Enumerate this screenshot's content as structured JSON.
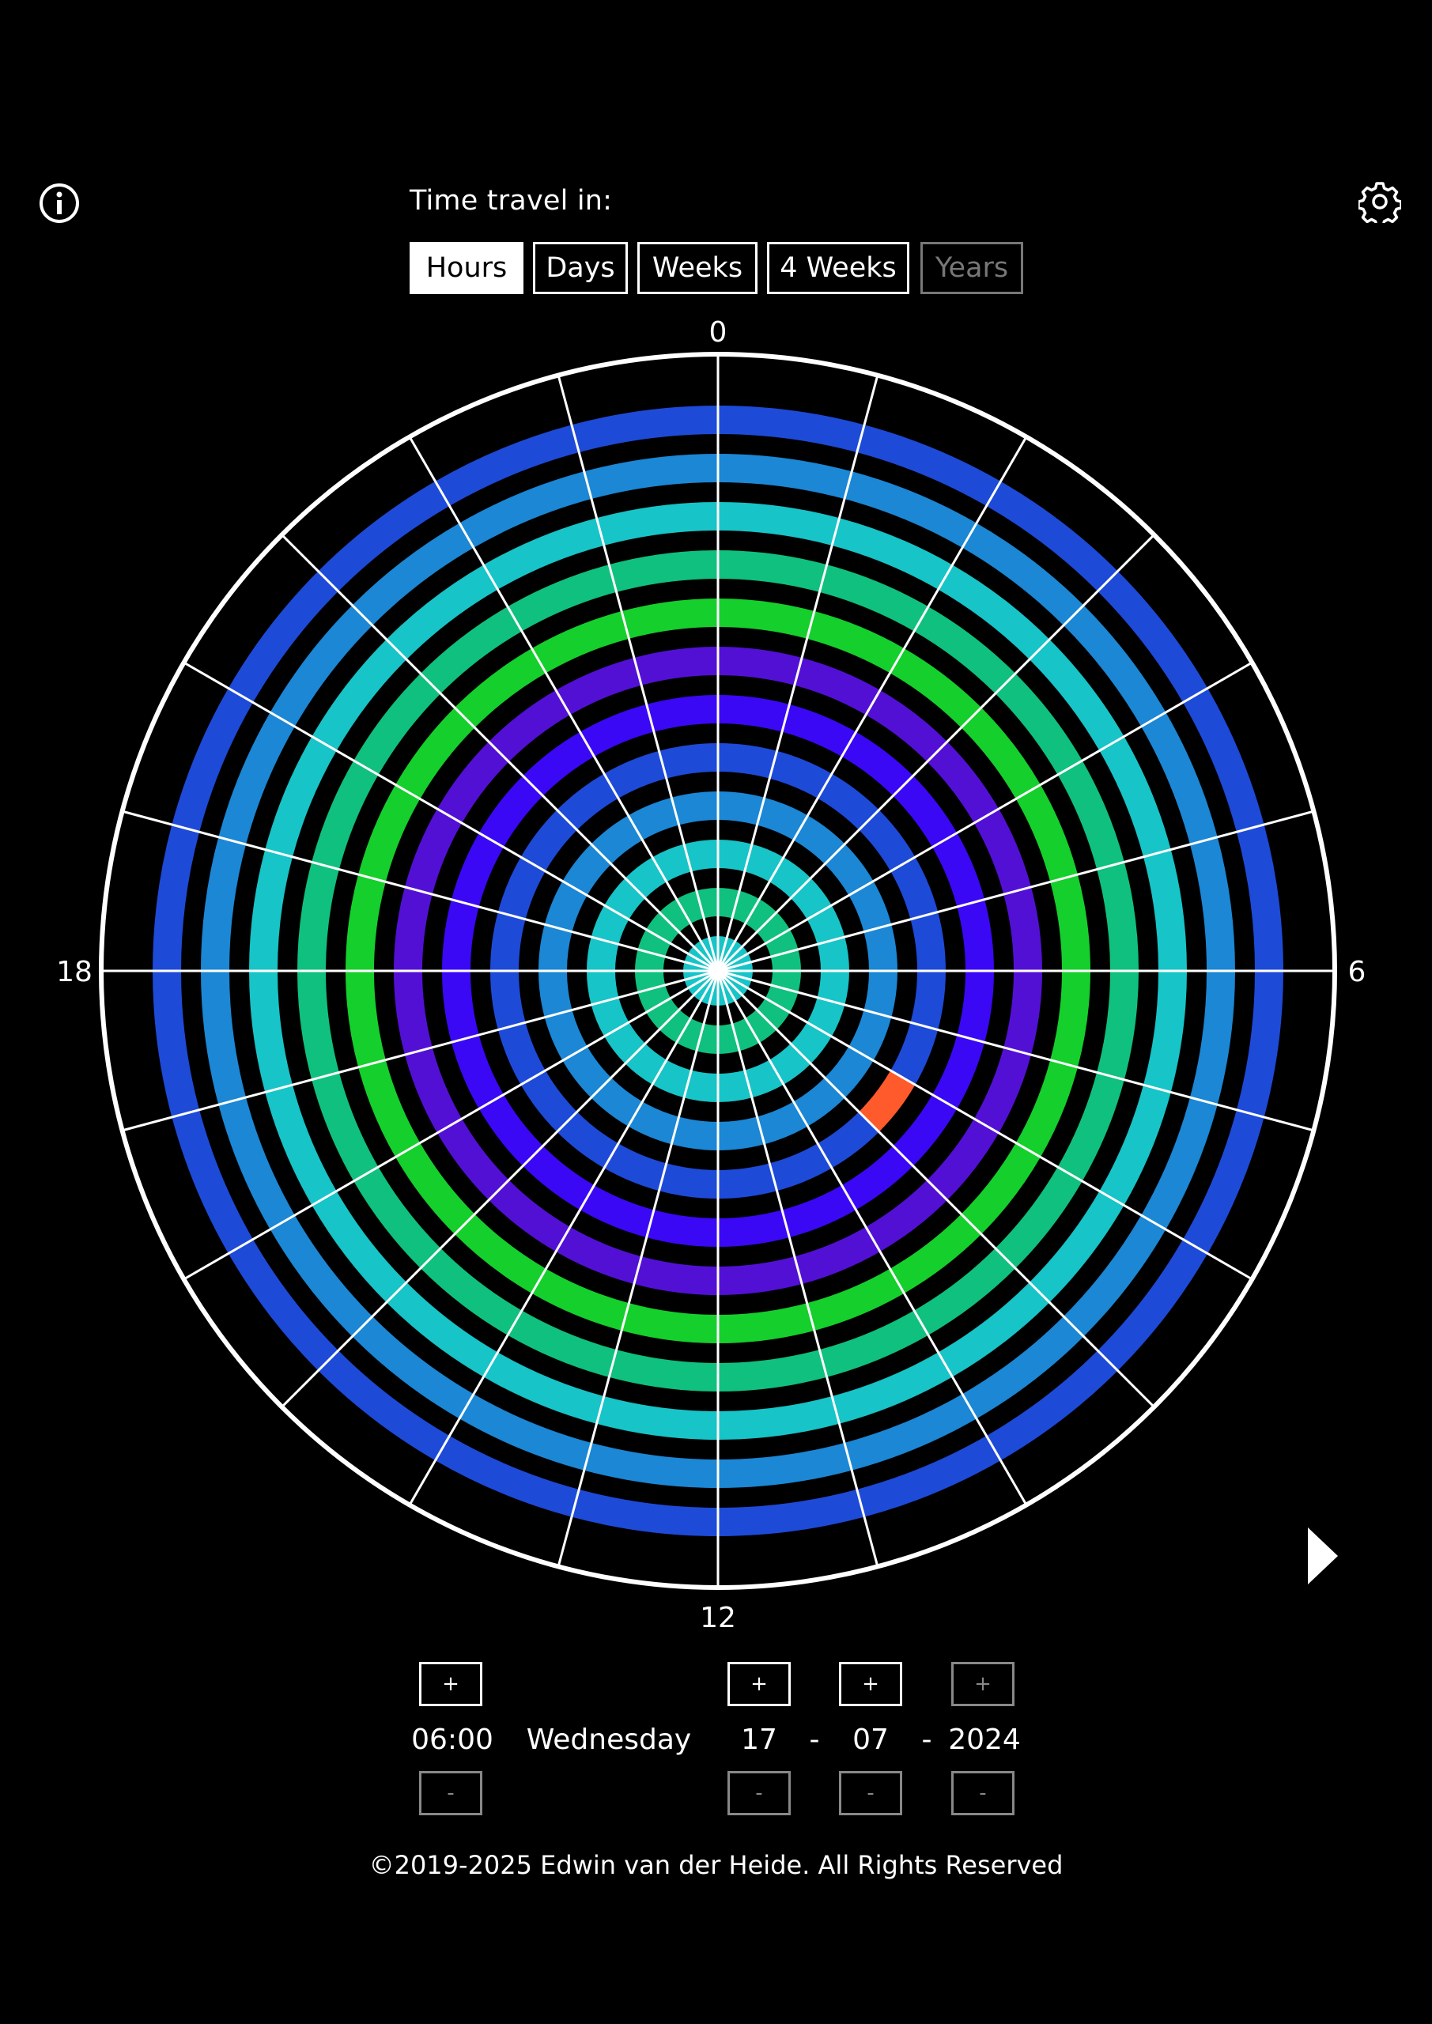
{
  "header": {
    "info_icon": "info-icon",
    "settings_icon": "gear-icon",
    "time_travel_label": "Time travel in:"
  },
  "modes": [
    {
      "label": "Hours",
      "state": "active"
    },
    {
      "label": "Days",
      "state": "normal"
    },
    {
      "label": "Weeks",
      "state": "normal"
    },
    {
      "label": "4 Weeks",
      "state": "normal"
    },
    {
      "label": "Years",
      "state": "disabled"
    }
  ],
  "clock": {
    "hour_labels": [
      "0",
      "6",
      "12",
      "18"
    ],
    "segments_per_ring": 24,
    "ring_count": 12,
    "ring_start_hour": 6,
    "rings_ordered_outer_to_inner": [
      "#1e4ad8",
      "#1b87d5",
      "#17c4c7",
      "#10c07e",
      "#15cf2c",
      "#5310d5",
      "#3a08f4",
      "#1e4ad8",
      "#1b87d5",
      "#17c4c7",
      "#10c07e",
      "#17c4c7"
    ],
    "highlight_color": "#ff5a2b",
    "highlight_ring_outer_index": 7,
    "highlight_segment_hours_after_start": 2,
    "outer_ring_outline": "#ffffff",
    "spoke_color": "#ffffff"
  },
  "controls": {
    "plus_label": "+",
    "minus_label": "-",
    "time": "06:00",
    "weekday": "Wednesday",
    "day": "17",
    "month": "07",
    "year": "2024",
    "separator": "-",
    "year_plus_disabled": true
  },
  "play_icon": "play-icon",
  "footer": {
    "copyright": "©2019-2025 Edwin van der Heide. All Rights Reserved"
  }
}
